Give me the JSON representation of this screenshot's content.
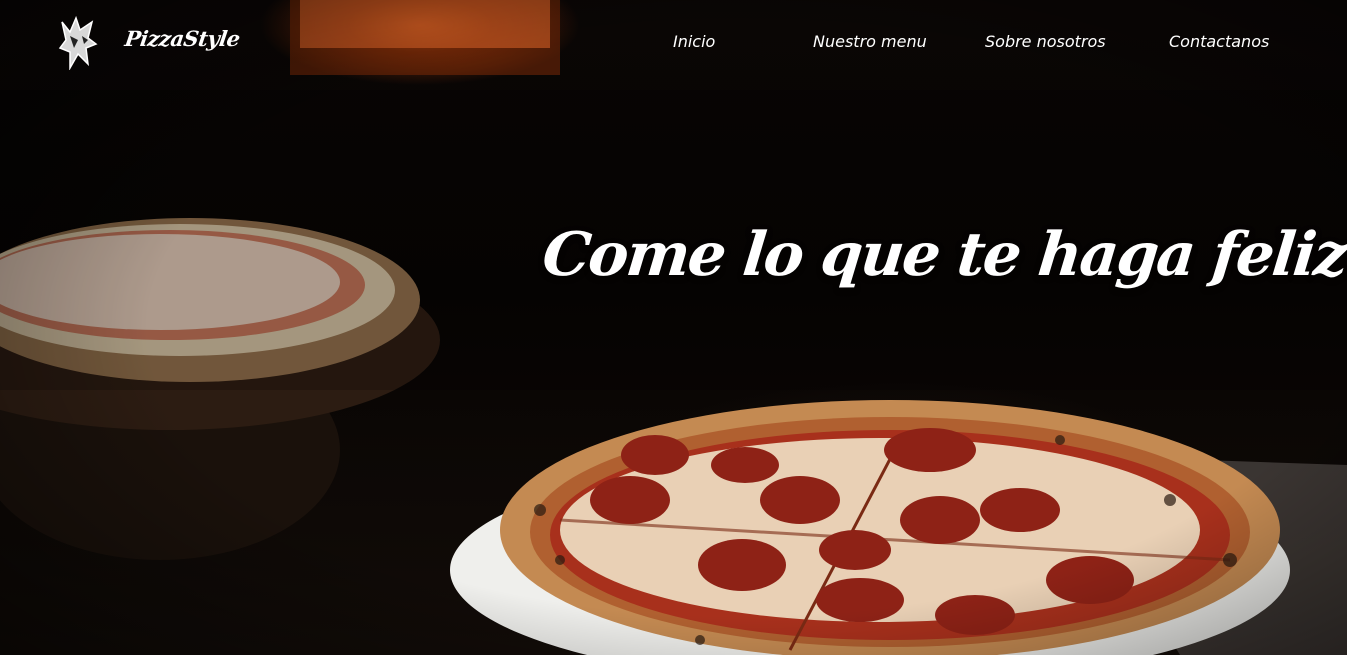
{
  "brand": {
    "name": "PizzaStyle",
    "logo_icon": "wolf-head-icon"
  },
  "nav": {
    "items": [
      {
        "label": "Inicio"
      },
      {
        "label": "Nuestro menu"
      },
      {
        "label": "Sobre nosotros"
      },
      {
        "label": "Contactanos"
      }
    ]
  },
  "hero": {
    "headline": "Come lo que te haga feliz",
    "background": "pizza-photo"
  },
  "colors": {
    "text": "#ffffff",
    "background": "#050302",
    "oven_glow": "#ff7a28",
    "sauce": "#a8301c",
    "pepperoni": "#8e2216",
    "cheese": "#efe2c6",
    "crust": "#c48a52"
  }
}
